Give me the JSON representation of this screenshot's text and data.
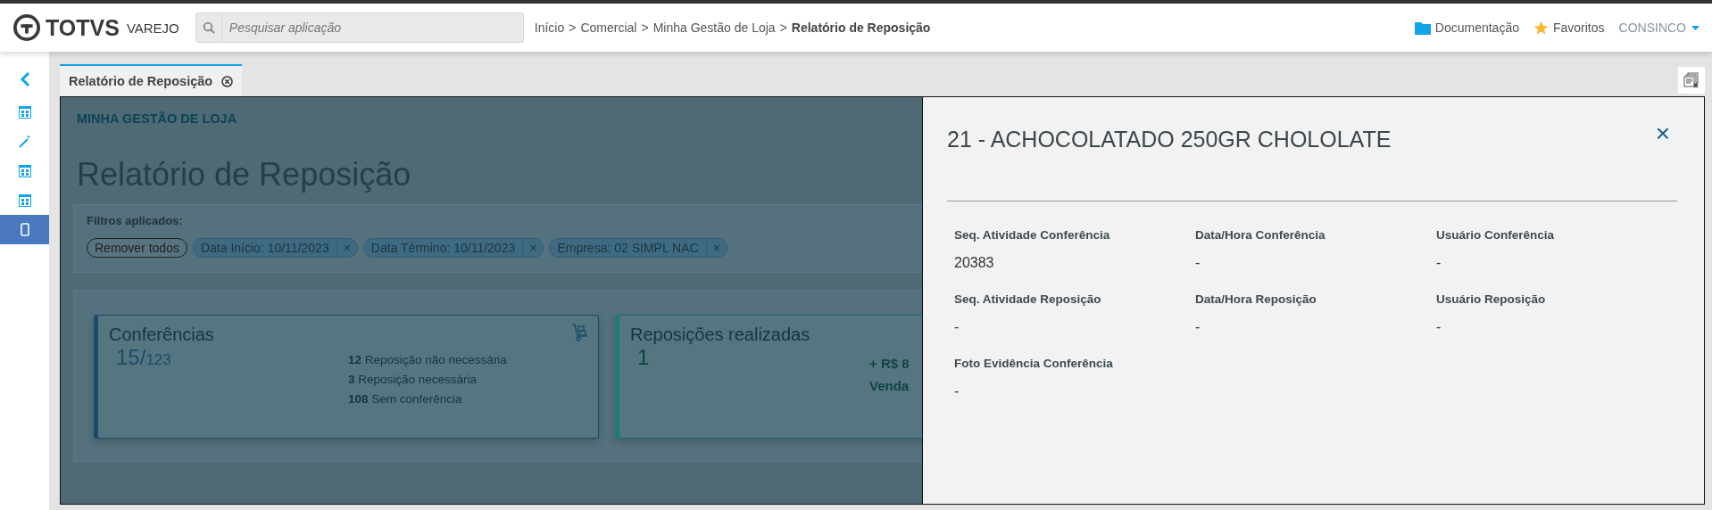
{
  "header": {
    "logo": {
      "brand": "TOTVS",
      "product": "VAREJO"
    },
    "search": {
      "placeholder": "Pesquisar aplicação"
    },
    "breadcrumb": [
      {
        "label": "Início",
        "current": false
      },
      {
        "label": "Comercial",
        "current": false
      },
      {
        "label": "Minha Gestão de Loja",
        "current": false
      },
      {
        "label": "Relatório de Reposição",
        "current": true
      }
    ],
    "breadcrumb_separator": ">",
    "links": [
      {
        "kind": "folder",
        "label": "Documentação"
      },
      {
        "kind": "star",
        "label": "Favoritos"
      }
    ],
    "user": "CONSINCO"
  },
  "sidebar": {
    "items": [
      {
        "kind": "table",
        "selected": false
      },
      {
        "kind": "wand",
        "selected": false
      },
      {
        "kind": "table",
        "selected": false
      },
      {
        "kind": "table",
        "selected": false
      },
      {
        "kind": "phone",
        "selected": true
      }
    ]
  },
  "tabs": [
    {
      "label": "Relatório de Reposição",
      "selected": true
    }
  ],
  "page": {
    "section": "MINHA GESTÃO DE LOJA",
    "title": "Relatório de Reposição",
    "filters": {
      "label": "Filtros aplicados:",
      "clear": "Remover todos",
      "remove": "×",
      "chips": [
        "Data Início: 10/11/2023",
        "Data Término: 10/11/2023",
        "Empresa: 02 SIMPL NAC"
      ]
    },
    "cards": [
      {
        "kind": "breakdown",
        "title": "Conferências",
        "value": "15/",
        "total": "123",
        "color": "#1b4a6a",
        "lines": [
          {
            "count": "12",
            "label": "Reposição não necessária"
          },
          {
            "count": "3",
            "label": "Reposição necessária"
          },
          {
            "count": "108",
            "label": "Sem conferência"
          }
        ]
      },
      {
        "kind": "amount",
        "title": "Reposições realizadas",
        "value": "1",
        "color": "#1c7d77",
        "lines": [
          "+ R$ 8",
          "Venda"
        ]
      }
    ]
  },
  "detail": {
    "title": "21 - ACHOCOLATADO 250GR CHOLOLATE",
    "close": "×",
    "fields": [
      {
        "label": "Seq. Atividade Conferência",
        "value": "20383"
      },
      {
        "label": "Data/Hora Conferência",
        "value": "-"
      },
      {
        "label": "Usuário Conferência",
        "value": "-"
      },
      {
        "label": "Seq. Atividade Reposição",
        "value": "-"
      },
      {
        "label": "Data/Hora Reposição",
        "value": "-"
      },
      {
        "label": "Usuário Reposição",
        "value": "-"
      },
      {
        "label": "Foto Evidência Conferência",
        "value": "-"
      }
    ]
  }
}
